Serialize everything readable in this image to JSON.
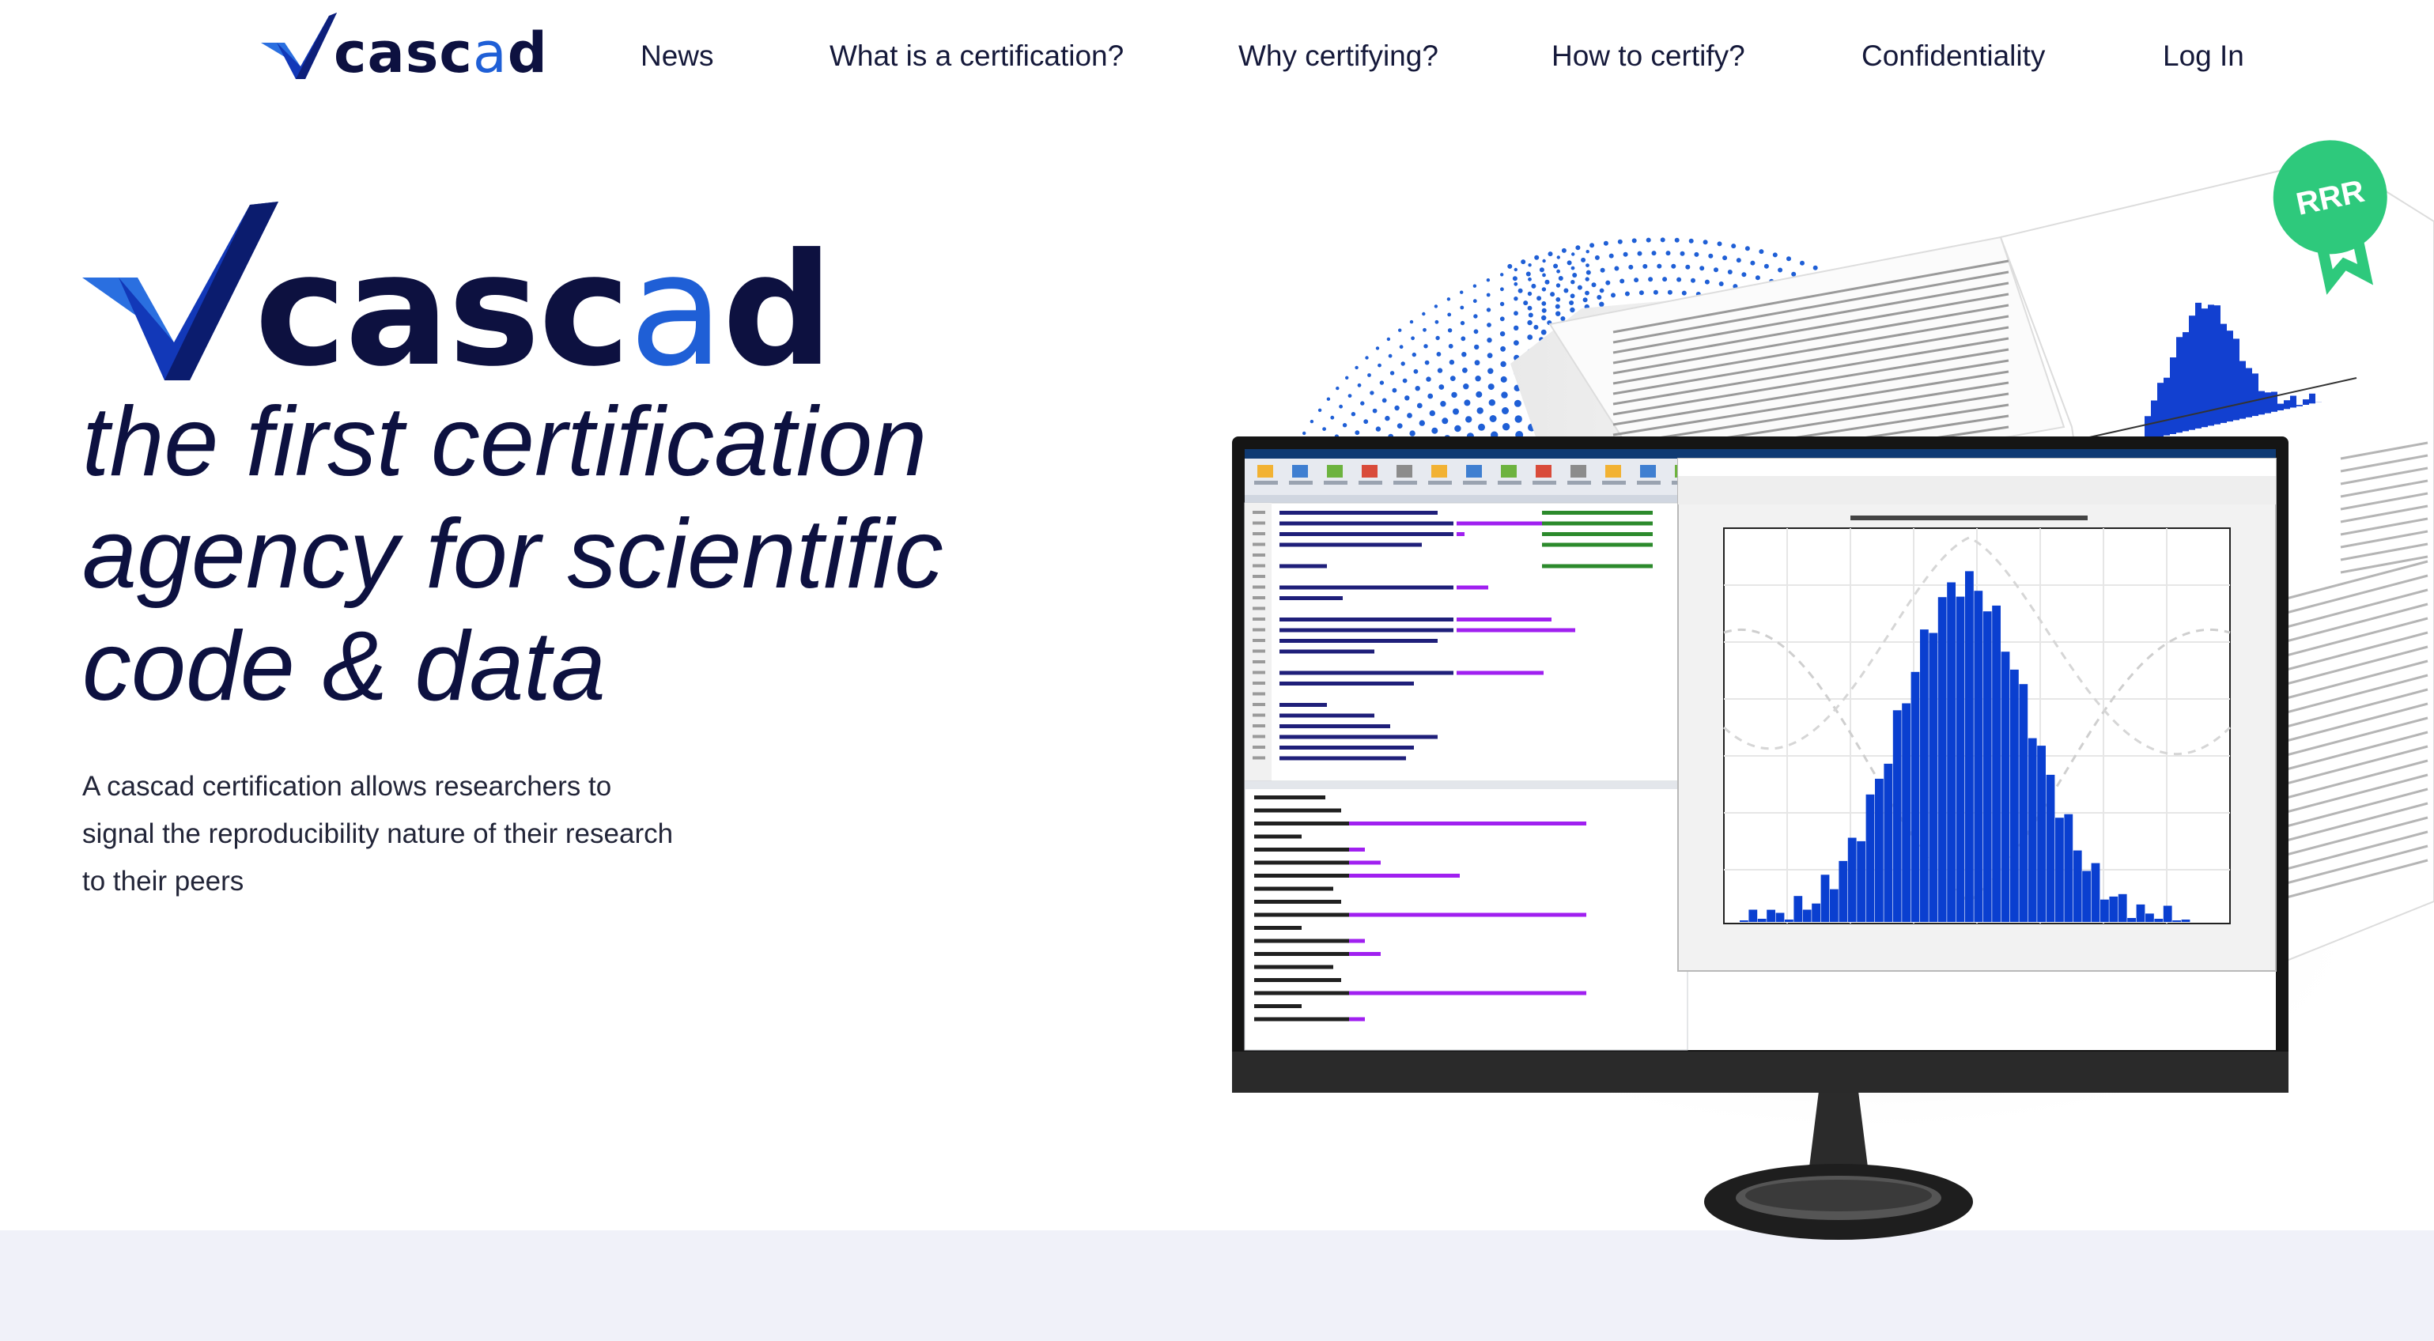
{
  "brand": {
    "name_main": "casc",
    "name_accent": "a",
    "name_end": "d"
  },
  "nav": {
    "items": [
      {
        "label": "News"
      },
      {
        "label": "What is a certification?"
      },
      {
        "label": "Why certifying?"
      },
      {
        "label": "How to certify?"
      },
      {
        "label": "Confidentiality"
      },
      {
        "label": "Log In"
      }
    ]
  },
  "hero": {
    "tagline_lines": [
      "the first certification",
      "agency for scientific",
      "code & data"
    ],
    "description_lines": [
      "A cascad certification allows researchers to",
      "signal the reproducibility nature of their research",
      "to their peers"
    ]
  },
  "badge": {
    "label": "RRR",
    "color": "#2ec97c"
  },
  "colors": {
    "navy": "#0d1140",
    "accent": "#1f5fd6",
    "histogram": "#0a3fd0",
    "band": "#f0f1f9"
  },
  "icons": [
    "checkmark-logo-icon",
    "ribbon-badge-icon"
  ]
}
